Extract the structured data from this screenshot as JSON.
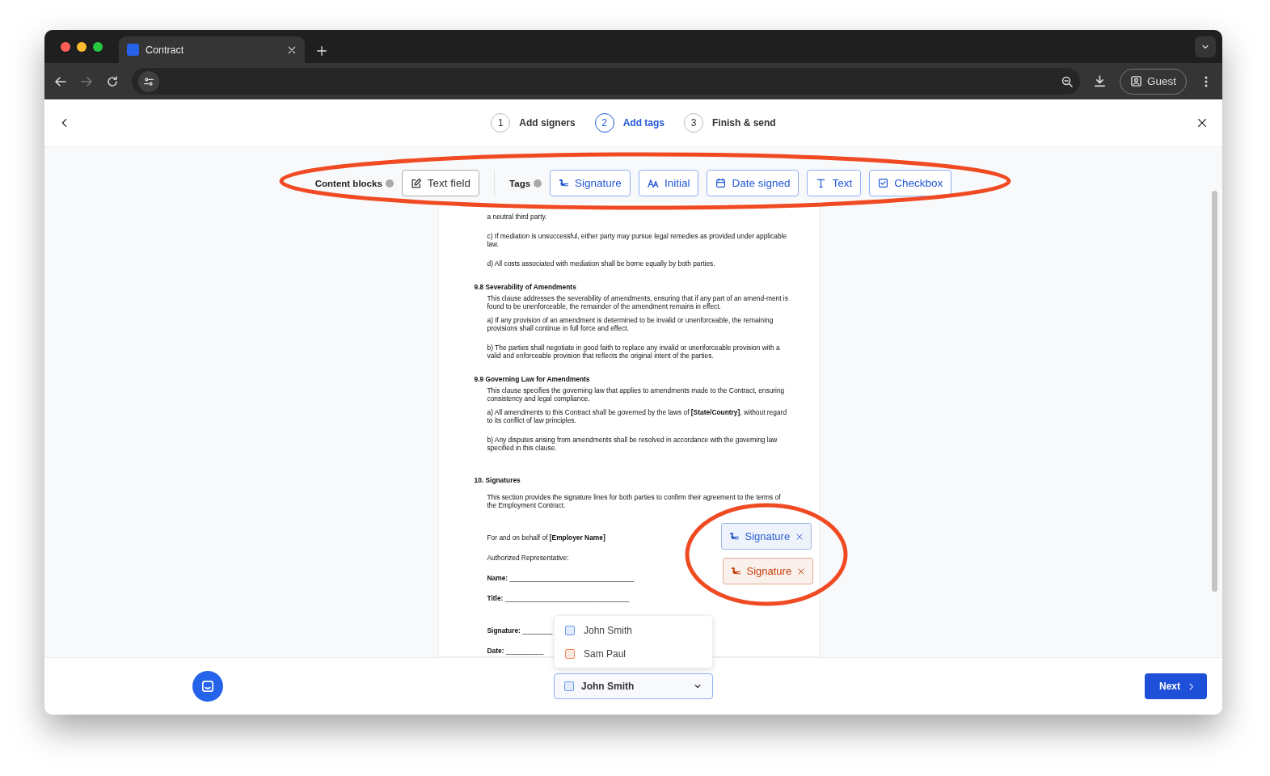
{
  "browser": {
    "tab_title": "Contract",
    "profile": "Guest"
  },
  "steps": [
    {
      "number": "1",
      "label": "Add signers",
      "selected": false
    },
    {
      "number": "2",
      "label": "Add tags",
      "selected": true
    },
    {
      "number": "3",
      "label": "Finish & send",
      "selected": false
    }
  ],
  "toolbar": {
    "circled": true,
    "content_blocks_label": "Content blocks",
    "content_blocks": [
      {
        "kind": "textfield",
        "label": "Text field"
      }
    ],
    "tags_label": "Tags",
    "tags": [
      {
        "kind": "signature",
        "label": "Signature"
      },
      {
        "kind": "initial",
        "label": "Initial"
      },
      {
        "kind": "date",
        "label": "Date signed"
      },
      {
        "kind": "text",
        "label": "Text"
      },
      {
        "kind": "checkbox",
        "label": "Checkbox"
      }
    ]
  },
  "document": [
    {
      "kind": "para",
      "text": "a neutral third party."
    },
    {
      "kind": "para",
      "text": "c) If mediation is unsuccessful, either party may pursue legal remedies as provided under applicable law."
    },
    {
      "kind": "para",
      "text": "d) All costs associated with mediation shall be borne equally by both parties."
    },
    {
      "kind": "heading",
      "text": "9.8 Severability of Amendments"
    },
    {
      "kind": "lead",
      "text": "This clause addresses the severability of amendments, ensuring that if any part of an amend-ment is found to be unenforceable, the remainder of the amendment remains in effect."
    },
    {
      "kind": "close",
      "text": "a) If any provision of an amendment is determined to be invalid or unenforceable, the remaining provisions shall continue in full force and effect."
    },
    {
      "kind": "para",
      "text": "b) The parties shall negotiate in good faith to replace any invalid or unenforceable provision with a valid and enforceable provision that reflects the original intent of the parties."
    },
    {
      "kind": "heading",
      "text": "9.9 Governing Law for Amendments"
    },
    {
      "kind": "lead",
      "text": "This clause specifies the governing law that applies to amendments made to the Contract, ensuring consistency and legal compliance."
    },
    {
      "kind": "close",
      "text": "a) All amendments to this Contract shall be governed by the laws of **[State/Country]**, without regard to its conflict of law principles."
    },
    {
      "kind": "para",
      "text": "b) Any disputes arising from amendments shall be resolved in accordance with the governing law specified in this clause."
    },
    {
      "kind": "section",
      "text": "10. Signatures"
    },
    {
      "kind": "para",
      "text": "This section provides the signature lines for both parties to confirm their agreement to the terms of the Employment Contract."
    },
    {
      "kind": "block",
      "text": "For and on behalf of **[Employer Name]**"
    },
    {
      "kind": "field",
      "text": "Authorized Representative:"
    },
    {
      "kind": "field",
      "text": "**Name:** _________________________________"
    },
    {
      "kind": "field",
      "text": "**Title:** _________________________________"
    },
    {
      "kind": "block",
      "text": "**Signature:** ________"
    },
    {
      "kind": "field",
      "text": "**Date:** __________"
    }
  ],
  "placed_tags": {
    "circled": true,
    "items": [
      {
        "label": "Signature",
        "color": "#2f5fd0"
      },
      {
        "label": "Signature",
        "color": "#c2410c"
      }
    ]
  },
  "signers": [
    {
      "name": "John Smith",
      "color": "#6b9bf0"
    },
    {
      "name": "Sam Paul",
      "color": "#f08a5d"
    }
  ],
  "signer_select": {
    "value": "John Smith",
    "color": "#6b9bf0",
    "open": true
  },
  "next_button": "Next"
}
